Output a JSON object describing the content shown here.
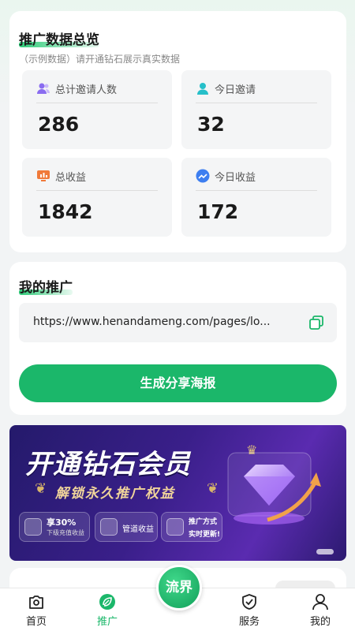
{
  "overview": {
    "title": "推广数据总览",
    "subtitle": "（示例数据）请开通钻石展示真实数据",
    "stats": [
      {
        "label": "总计邀请人数",
        "value": "286",
        "icon": "users-icon",
        "color": "#8a6cf0"
      },
      {
        "label": "今日邀请",
        "value": "32",
        "icon": "user-icon",
        "color": "#26bfc9"
      },
      {
        "label": "总收益",
        "value": "1842",
        "icon": "income-chart-icon",
        "color": "#f07a3a"
      },
      {
        "label": "今日收益",
        "value": "172",
        "icon": "trend-icon",
        "color": "#3d7ef0"
      }
    ]
  },
  "promo": {
    "title": "我的推广",
    "link": "https://www.henandameng.com/pages/lo...",
    "button_label": "生成分享海报"
  },
  "banner": {
    "title": "开通钻石会员",
    "subtitle": "解锁永久推广权益",
    "features": [
      {
        "line1": "享30%",
        "line2": "下级充值收益"
      },
      {
        "line1": "管道收益"
      },
      {
        "line1": "推广方式",
        "line2": "实时更新!"
      }
    ]
  },
  "tabbar": {
    "center_label": "流界",
    "tabs": [
      {
        "label": "首页",
        "icon": "home-camera-icon"
      },
      {
        "label": "推广",
        "icon": "leaf-icon"
      },
      {
        "label": "服务",
        "icon": "shield-check-icon"
      },
      {
        "label": "我的",
        "icon": "person-icon"
      }
    ],
    "active_color": "#1bb76a"
  }
}
